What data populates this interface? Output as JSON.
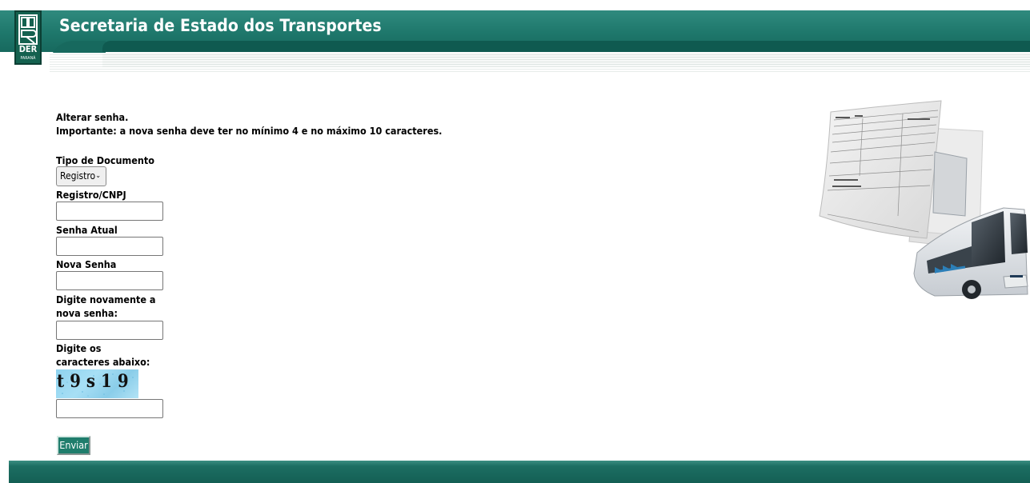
{
  "header": {
    "title": "Secretaria de Estado dos Transportes",
    "logo_text": "DER",
    "logo_subtext": "PARANÁ"
  },
  "intro": {
    "line1": "Alterar senha.",
    "line2": "Importante: a nova senha deve ter no mínimo 4 e no máximo 10 caracteres."
  },
  "form": {
    "tipo_documento_label": "Tipo de Documento",
    "tipo_documento_selected": "Registro",
    "registro_label": "Registro/CNPJ",
    "registro_value": "",
    "senha_atual_label": "Senha Atual",
    "senha_atual_value": "",
    "nova_senha_label": "Nova Senha",
    "nova_senha_value": "",
    "confirma_label": "Digite novamente a nova senha:",
    "confirma_value": "",
    "captcha_label": "Digite os caracteres abaixo:",
    "captcha_text": "t9s19",
    "captcha_value": "",
    "submit_label": "Enviar"
  },
  "icons": {
    "select_chevron": "chevron-down-icon",
    "illustration": "document-and-bus-illustration"
  },
  "colors": {
    "header": "#1e776b",
    "footer": "#17695e",
    "button": "#1f7d6c",
    "captcha_bg": "#9ed8f1"
  }
}
